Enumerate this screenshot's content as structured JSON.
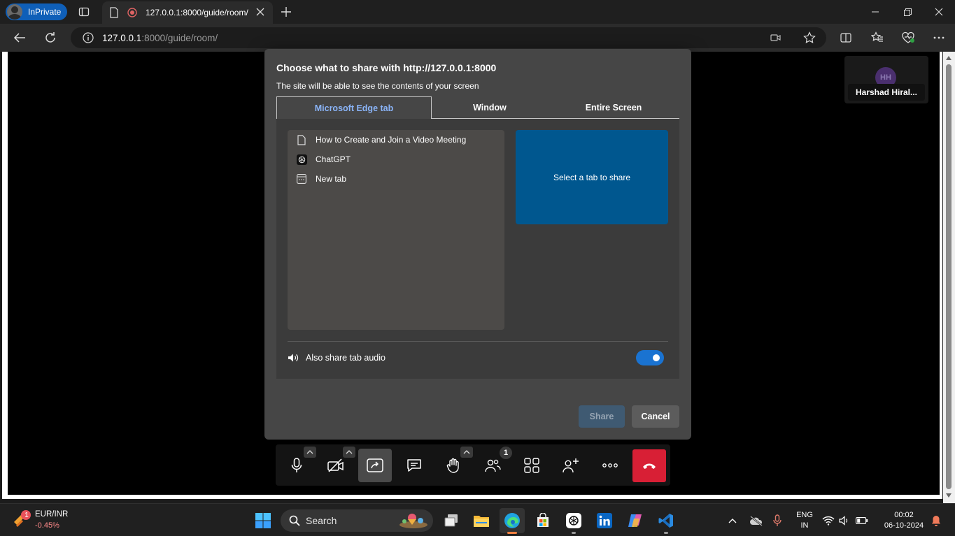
{
  "browser": {
    "inprivate_label": "InPrivate",
    "tab_title": "127.0.0.1:8000/guide/room/",
    "url_host": "127.0.0.1",
    "url_rest": ":8000/guide/room/"
  },
  "participant": {
    "initials": "HH",
    "name": "Harshad Hiral..."
  },
  "dialog": {
    "title": "Choose what to share with http://127.0.0.1:8000",
    "subtitle": "The site will be able to see the contents of your screen",
    "tabs": [
      "Microsoft Edge tab",
      "Window",
      "Entire Screen"
    ],
    "selected_tab": "Microsoft Edge tab",
    "tab_list": [
      {
        "label": "How to Create and Join a Video Meeting",
        "icon": "page-icon"
      },
      {
        "label": "ChatGPT",
        "icon": "chatgpt-icon"
      },
      {
        "label": "New tab",
        "icon": "newtab-icon"
      }
    ],
    "preview_text": "Select a tab to share",
    "audio_label": "Also share tab audio",
    "audio_enabled": true,
    "share_label": "Share",
    "cancel_label": "Cancel"
  },
  "meeting_toolbar": {
    "participants_count": "1"
  },
  "taskbar": {
    "widget_badge": "1",
    "currency_pair": "EUR/INR",
    "currency_change": "-0.45%",
    "search_placeholder": "Search",
    "lang": "ENG",
    "region": "IN",
    "time": "00:02",
    "date": "06-10-2024"
  },
  "colors": {
    "accent": "#1a73d1",
    "preview_bg": "#00578f",
    "end_call": "#d81f35",
    "selected_tab_text": "#8ab4f8"
  }
}
